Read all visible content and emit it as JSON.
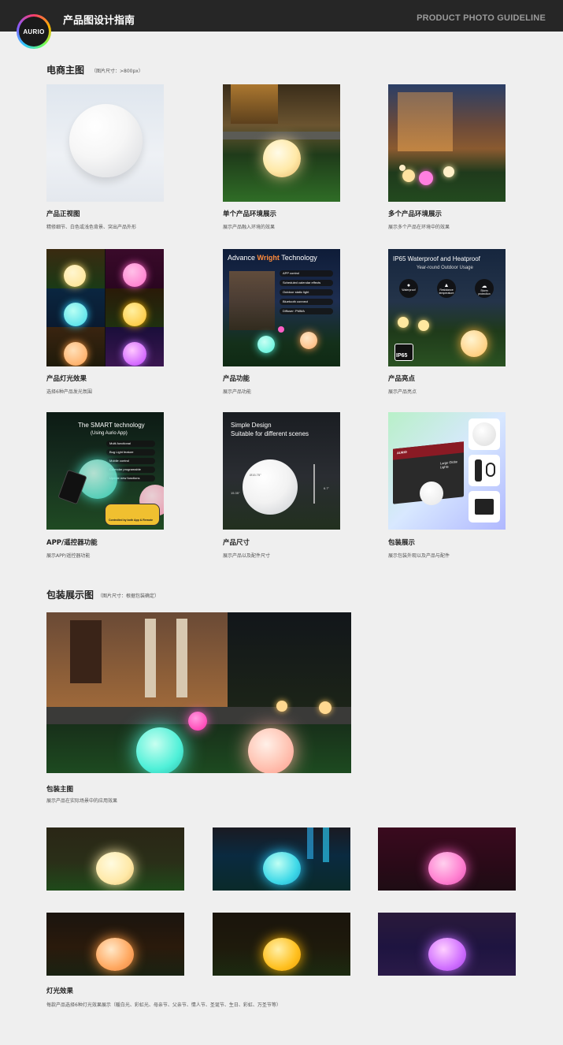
{
  "header": {
    "logo_text": "AURIO",
    "title": "产品图设计指南",
    "subtitle_en": "PRODUCT PHOTO GUIDELINE"
  },
  "section1": {
    "title": "电商主图",
    "note": "（图片尺寸：>800px）",
    "items": [
      {
        "caption": "产品正视图",
        "desc": "精修细节、白色或浅色背景、突出产品外形"
      },
      {
        "caption": "单个产品环境展示",
        "desc": "展示产品融入环境的效果"
      },
      {
        "caption": "多个产品环境展示",
        "desc": "展示多个产品在环境中的效果"
      },
      {
        "caption": "产品灯光效果",
        "desc": "选择6种产品发光氛围"
      },
      {
        "caption": "产品功能",
        "desc": "展示产品功能"
      },
      {
        "caption": "产品亮点",
        "desc": "展示产品亮点"
      },
      {
        "caption": "APP/遥控器功能",
        "desc": "展示APP/遥控器功能"
      },
      {
        "caption": "产品尺寸",
        "desc": "展示产品以及配件尺寸"
      },
      {
        "caption": "包装展示",
        "desc": "展示包装外观以及产品与配件"
      }
    ]
  },
  "tech_img": {
    "title_pre": "Advance ",
    "title_brand": "Wright",
    "title_post": " Technology",
    "features": [
      "APP control",
      "Scheduled calendar effects",
      "Outdoor static light",
      "Bluetooth connect",
      "Diffuser: PMMA"
    ]
  },
  "ip65_img": {
    "title": "IP65 Waterproof and Heatproof",
    "subtitle": "Year-round Outdoor Usage",
    "icons": [
      "Waterproof",
      "Resistance temperature",
      "Storm protection"
    ],
    "badge": "IP65"
  },
  "smart_img": {
    "title": "The SMART technology",
    "subtitle": "(Using Aurio App)",
    "features": [
      "Multi-functional",
      "Bug Light feature",
      "Mobile control",
      "Calendar programable",
      "Update new functions"
    ],
    "bottom": "Controlled by both App & Remote"
  },
  "size_img": {
    "title_line1": "Simple Design",
    "title_line2": "Suitable for different scenes",
    "dim_diameter": "Ø15.75\"",
    "dim_height": "15.35\"",
    "dim_stake": "6.7\""
  },
  "pack_img": {
    "box_text": "Large Globe Lights",
    "brand": "AURIO"
  },
  "section2": {
    "title": "包装展示图",
    "note": "（图片尺寸：根据包装确定）",
    "main_caption": "包装主图",
    "main_desc": "展示产品在实际场景中的应用效果",
    "light_caption": "灯光效果",
    "light_desc": "每款产品选择6种灯光效果展示（暖白光、彩虹光、母亲节、父亲节、情人节、圣诞节、生日、彩虹、万圣节等）"
  },
  "colors": {
    "warm": "#ffe9a8",
    "teal": "#4ff0d8",
    "pink": "#ff5fc6",
    "orange": "#ffbb55",
    "purple": "#c36bff"
  }
}
